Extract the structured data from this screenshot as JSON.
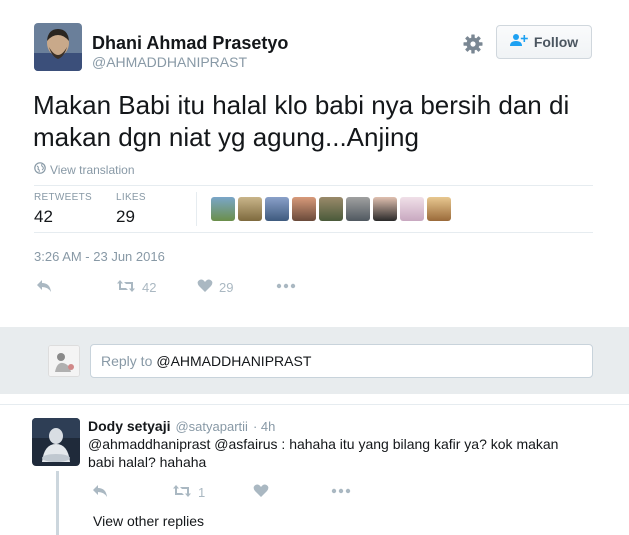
{
  "tweet": {
    "author_name": "Dhani Ahmad Prasetyo",
    "author_handle": "@AHMADDHANIPRAST",
    "follow_label": "Follow",
    "text": "Makan Babi itu halal klo babi nya bersih dan di makan dgn niat yg agung...Anjing",
    "translate_label": "View translation",
    "retweets_label": "RETWEETS",
    "retweets_count": "42",
    "likes_label": "LIKES",
    "likes_count": "29",
    "timestamp": "3:26 AM - 23 Jun 2016",
    "action_retweet_count": "42",
    "action_like_count": "29"
  },
  "reply_box": {
    "placeholder_prefix": "Reply to",
    "placeholder_handle": "@AHMADDHANIPRAST"
  },
  "reply": {
    "name": "Dody setyaji",
    "handle": "@satyapartii",
    "time": "· 4h",
    "text": "@ahmaddhaniprast @asfairus : hahaha itu yang bilang kafir ya? kok makan babi halal? hahaha",
    "retweet_count": "1",
    "view_other": "View other replies"
  },
  "icons": {
    "gear": "gear-icon",
    "follow": "add-user-icon",
    "globe": "globe-icon",
    "reply": "reply-icon",
    "retweet": "retweet-icon",
    "like": "heart-icon",
    "more": "more-icon"
  },
  "colors": {
    "accent": "#1da1f2",
    "muted": "#8899a6",
    "action": "#aab8c2"
  }
}
